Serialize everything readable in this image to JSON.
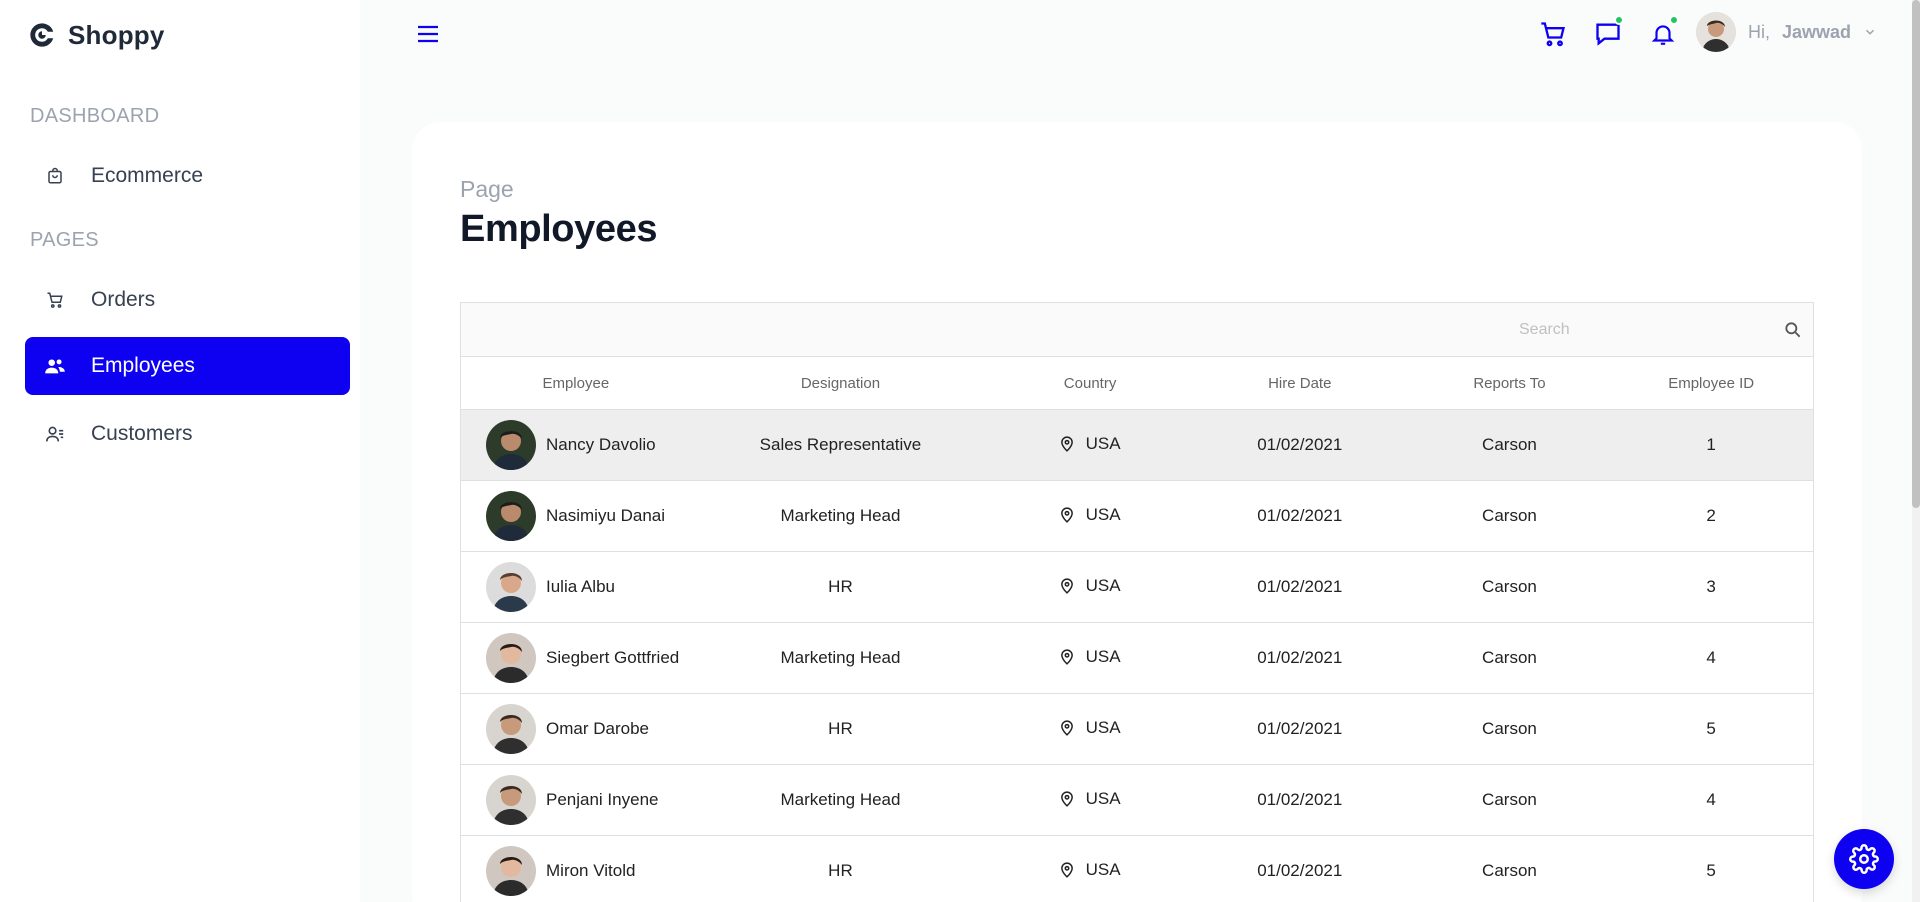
{
  "brand": {
    "name": "Shoppy"
  },
  "sidebar": {
    "sections": [
      {
        "title": "DASHBOARD",
        "items": [
          {
            "label": "Ecommerce",
            "icon": "shopping-bag-icon"
          }
        ]
      },
      {
        "title": "PAGES",
        "items": [
          {
            "label": "Orders",
            "icon": "cart-icon"
          },
          {
            "label": "Employees",
            "icon": "employees-icon",
            "active": true
          },
          {
            "label": "Customers",
            "icon": "customers-icon"
          }
        ]
      }
    ]
  },
  "topbar": {
    "greeting": "Hi,",
    "user_name": "Jawwad",
    "icons": [
      "menu-icon",
      "cart-icon",
      "chat-icon",
      "bell-icon",
      "chevron-down-icon"
    ]
  },
  "page": {
    "category": "Page",
    "title": "Employees"
  },
  "grid": {
    "search": {
      "placeholder": "Search"
    },
    "columns": [
      "Employee",
      "Designation",
      "Country",
      "Hire Date",
      "Reports To",
      "Employee ID"
    ],
    "rows": [
      {
        "name": "Nancy Davolio",
        "designation": "Sales Representative",
        "country": "USA",
        "hire_date": "01/02/2021",
        "reports_to": "Carson",
        "id": "1",
        "selected": true
      },
      {
        "name": "Nasimiyu Danai",
        "designation": "Marketing Head",
        "country": "USA",
        "hire_date": "01/02/2021",
        "reports_to": "Carson",
        "id": "2"
      },
      {
        "name": "Iulia Albu",
        "designation": "HR",
        "country": "USA",
        "hire_date": "01/02/2021",
        "reports_to": "Carson",
        "id": "3"
      },
      {
        "name": "Siegbert Gottfried",
        "designation": "Marketing Head",
        "country": "USA",
        "hire_date": "01/02/2021",
        "reports_to": "Carson",
        "id": "4"
      },
      {
        "name": "Omar Darobe",
        "designation": "HR",
        "country": "USA",
        "hire_date": "01/02/2021",
        "reports_to": "Carson",
        "id": "5"
      },
      {
        "name": "Penjani Inyene",
        "designation": "Marketing Head",
        "country": "USA",
        "hire_date": "01/02/2021",
        "reports_to": "Carson",
        "id": "4"
      },
      {
        "name": "Miron Vitold",
        "designation": "HR",
        "country": "USA",
        "hire_date": "01/02/2021",
        "reports_to": "Carson",
        "id": "5"
      }
    ]
  },
  "colors": {
    "accent": "#0e00f0",
    "notification_dot": "#22c55e"
  }
}
